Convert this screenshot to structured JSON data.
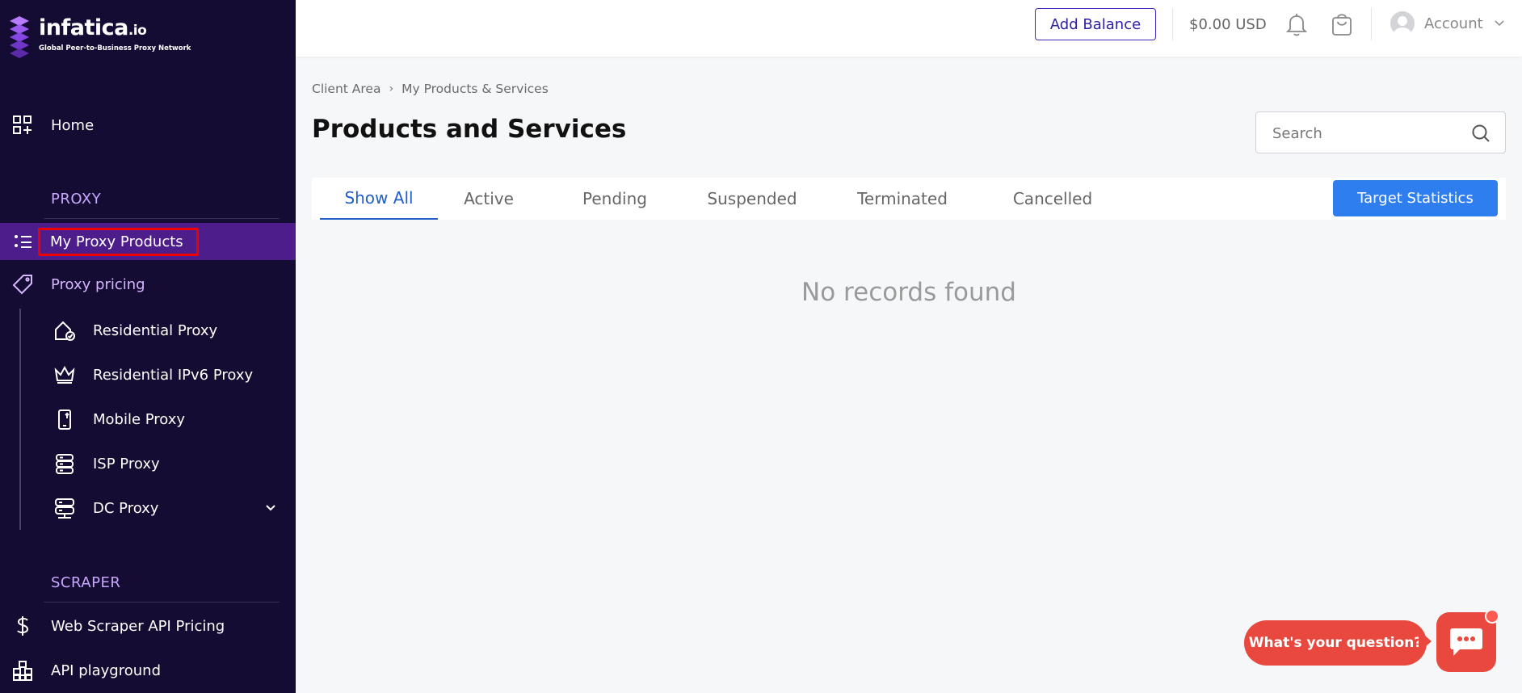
{
  "brand": {
    "name": "infatica",
    "tld": ".io",
    "tagline": "Global Peer-to-Business Proxy Network",
    "colors": {
      "sidebar_bg": "#150c33",
      "active_item": "#4e1d8c",
      "accent_blue": "#2f7ef0",
      "chat_red": "#e8483e"
    }
  },
  "sidebar": {
    "home": {
      "label": "Home",
      "icon": "dashboard-grid-icon"
    },
    "proxy_section": "PROXY",
    "my_proxy_products": {
      "label": "My Proxy Products",
      "icon": "list-star-icon"
    },
    "proxy_pricing": {
      "label": "Proxy pricing",
      "icon": "price-tag-icon"
    },
    "proxy_items": [
      {
        "label": "Residential Proxy",
        "icon": "house-check-icon"
      },
      {
        "label": "Residential IPv6 Proxy",
        "icon": "crown-icon"
      },
      {
        "label": "Mobile Proxy",
        "icon": "mobile-phone-icon"
      },
      {
        "label": "ISP Proxy",
        "icon": "server-stack-icon"
      },
      {
        "label": "DC Proxy",
        "icon": "server-rack-icon"
      }
    ],
    "scraper_section": "SCRAPER",
    "web_scraper": {
      "label": "Web Scraper API Pricing",
      "icon": "dollar-icon"
    },
    "api_playground": {
      "label": "API playground",
      "icon": "blocks-icon"
    }
  },
  "topbar": {
    "add_balance": "Add Balance",
    "balance": "$0.00 USD",
    "account": "Account"
  },
  "breadcrumb": {
    "root": "Client Area",
    "current": "My Products & Services"
  },
  "page": {
    "title": "Products and Services",
    "search_placeholder": "Search",
    "tabs": [
      "Show All",
      "Active",
      "Pending",
      "Suspended",
      "Terminated",
      "Cancelled"
    ],
    "active_tab": "Show All",
    "target_statistics": "Target Statistics",
    "empty_message": "No records found"
  },
  "chat": {
    "prompt": "What's your question?"
  }
}
